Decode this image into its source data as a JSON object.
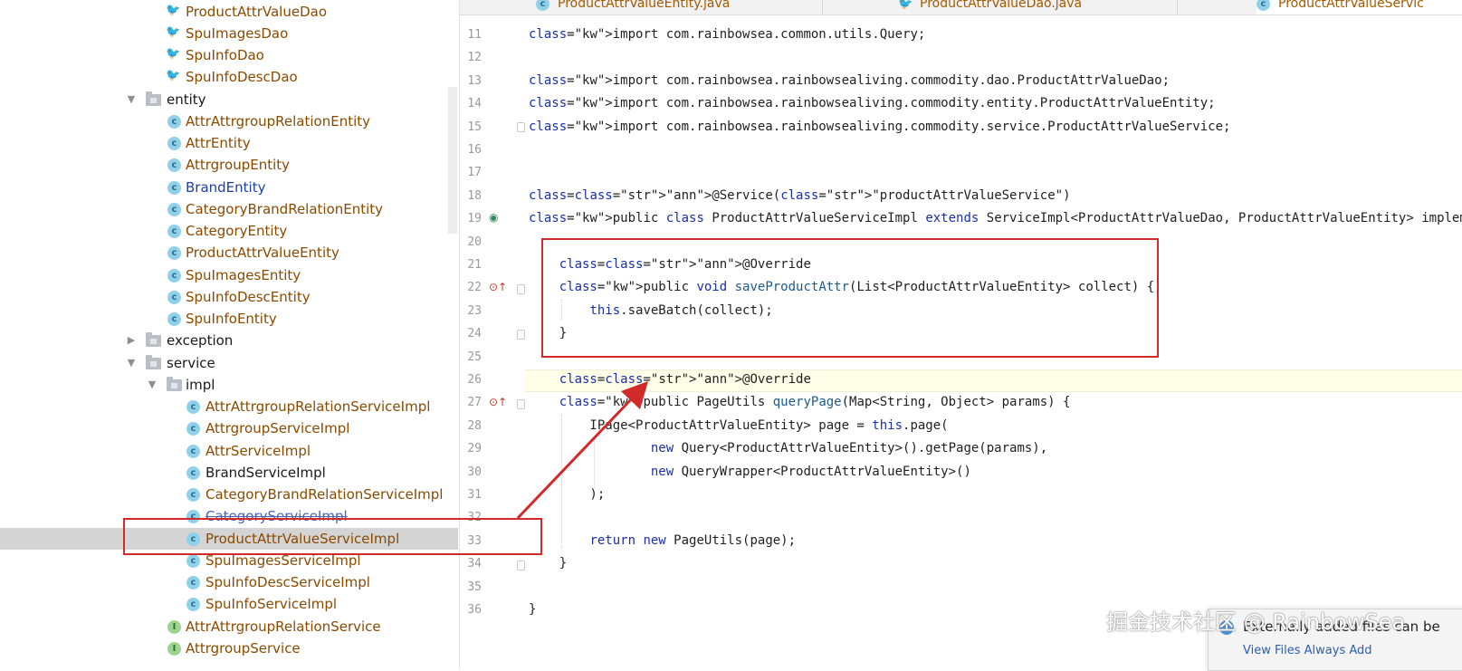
{
  "tree": {
    "items": [
      {
        "label": "ProductAttrValueDao",
        "icon": "dao-icon",
        "color": "orange"
      },
      {
        "label": "SpuImagesDao",
        "icon": "dao-icon",
        "color": "orange"
      },
      {
        "label": "SpuInfoDao",
        "icon": "dao-icon",
        "color": "orange"
      },
      {
        "label": "SpuInfoDescDao",
        "icon": "dao-icon",
        "color": "orange"
      },
      {
        "label": "entity",
        "icon": "folder-icon",
        "color": "black",
        "expanded": true
      },
      {
        "label": "AttrAttrgroupRelationEntity",
        "icon": "class-icon",
        "color": "orange"
      },
      {
        "label": "AttrEntity",
        "icon": "class-icon",
        "color": "orange"
      },
      {
        "label": "AttrgroupEntity",
        "icon": "class-icon",
        "color": "orange"
      },
      {
        "label": "BrandEntity",
        "icon": "class-icon",
        "color": "blue"
      },
      {
        "label": "CategoryBrandRelationEntity",
        "icon": "class-icon",
        "color": "orange"
      },
      {
        "label": "CategoryEntity",
        "icon": "class-icon",
        "color": "orange"
      },
      {
        "label": "ProductAttrValueEntity",
        "icon": "class-icon",
        "color": "orange"
      },
      {
        "label": "SpuImagesEntity",
        "icon": "class-icon",
        "color": "orange"
      },
      {
        "label": "SpuInfoDescEntity",
        "icon": "class-icon",
        "color": "orange"
      },
      {
        "label": "SpuInfoEntity",
        "icon": "class-icon",
        "color": "orange"
      },
      {
        "label": "exception",
        "icon": "folder-icon",
        "color": "black",
        "expanded": false
      },
      {
        "label": "service",
        "icon": "folder-icon",
        "color": "black",
        "expanded": true
      },
      {
        "label": "impl",
        "icon": "folder-icon",
        "color": "black",
        "expanded": true
      },
      {
        "label": "AttrAttrgroupRelationServiceImpl",
        "icon": "class-icon",
        "color": "orange"
      },
      {
        "label": "AttrgroupServiceImpl",
        "icon": "class-icon",
        "color": "orange"
      },
      {
        "label": "AttrServiceImpl",
        "icon": "class-icon",
        "color": "orange"
      },
      {
        "label": "BrandServiceImpl",
        "icon": "class-icon",
        "color": "black"
      },
      {
        "label": "CategoryBrandRelationServiceImpl",
        "icon": "class-icon",
        "color": "orange"
      },
      {
        "label": "CategoryServiceImpl",
        "icon": "class-icon",
        "color": "strike"
      },
      {
        "label": "ProductAttrValueServiceImpl",
        "icon": "class-icon",
        "color": "orange",
        "selected": true
      },
      {
        "label": "SpuImagesServiceImpl",
        "icon": "class-icon",
        "color": "orange"
      },
      {
        "label": "SpuInfoDescServiceImpl",
        "icon": "class-icon",
        "color": "orange"
      },
      {
        "label": "SpuInfoServiceImpl",
        "icon": "class-icon",
        "color": "orange"
      },
      {
        "label": "AttrAttrgroupRelationService",
        "icon": "interface-icon",
        "color": "orange"
      },
      {
        "label": "AttrgroupService",
        "icon": "interface-icon",
        "color": "orange"
      }
    ]
  },
  "tabs": [
    {
      "label": "ProductAttrValueEntity.java",
      "icon": "class-icon"
    },
    {
      "label": "ProductAttrValueDao.java",
      "icon": "dao-icon"
    },
    {
      "label": "ProductAttrValueServic",
      "icon": "class-icon",
      "active": true
    }
  ],
  "code": {
    "lines": [
      {
        "n": "11",
        "text": "import com.rainbowsea.common.utils.Query;"
      },
      {
        "n": "12",
        "text": ""
      },
      {
        "n": "13",
        "text": "import com.rainbowsea.rainbowsealiving.commodity.dao.ProductAttrValueDao;"
      },
      {
        "n": "14",
        "text": "import com.rainbowsea.rainbowsealiving.commodity.entity.ProductAttrValueEntity;"
      },
      {
        "n": "15",
        "text": "import com.rainbowsea.rainbowsealiving.commodity.service.ProductAttrValueService;"
      },
      {
        "n": "16",
        "text": ""
      },
      {
        "n": "17",
        "text": ""
      },
      {
        "n": "18",
        "text": "@Service(\"productAttrValueService\")"
      },
      {
        "n": "19",
        "text": "public class ProductAttrValueServiceImpl extends ServiceImpl<ProductAttrValueDao, ProductAttrValueEntity> impleme"
      },
      {
        "n": "20",
        "text": ""
      },
      {
        "n": "21",
        "text": "    @Override"
      },
      {
        "n": "22",
        "text": "    public void saveProductAttr(List<ProductAttrValueEntity> collect) {"
      },
      {
        "n": "23",
        "text": "        this.saveBatch(collect);"
      },
      {
        "n": "24",
        "text": "    }"
      },
      {
        "n": "25",
        "text": ""
      },
      {
        "n": "26",
        "text": "    @Override"
      },
      {
        "n": "27",
        "text": "    public PageUtils queryPage(Map<String, Object> params) {"
      },
      {
        "n": "28",
        "text": "        IPage<ProductAttrValueEntity> page = this.page("
      },
      {
        "n": "29",
        "text": "                new Query<ProductAttrValueEntity>().getPage(params),"
      },
      {
        "n": "30",
        "text": "                new QueryWrapper<ProductAttrValueEntity>()"
      },
      {
        "n": "31",
        "text": "        );"
      },
      {
        "n": "32",
        "text": ""
      },
      {
        "n": "33",
        "text": "        return new PageUtils(page);"
      },
      {
        "n": "34",
        "text": "    }"
      },
      {
        "n": "35",
        "text": ""
      },
      {
        "n": "36",
        "text": "}"
      }
    ]
  },
  "notification": {
    "text": "Externally added files can be",
    "sub": "View Files  Always Add"
  },
  "watermark": "掘金技术社区 @ RainbowSea",
  "colors": {
    "highlight_box": "#d22a2a",
    "selection": "#d4d4d4",
    "tab_underline": "#4083c9"
  }
}
